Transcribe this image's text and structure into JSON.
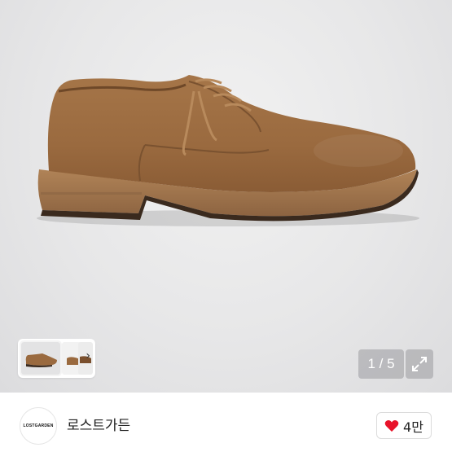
{
  "gallery": {
    "current_page": "1",
    "total_pages": "5",
    "page_indicator": "1 / 5",
    "thumbnail_next_glyph": "›"
  },
  "store": {
    "logo_text": "LOSTGARDEN",
    "name": "로스트가든"
  },
  "like": {
    "count": "4만",
    "heart_color": "#e8132a"
  },
  "icons": {
    "expand": "expand-icon",
    "heart": "heart-icon",
    "chevron": "chevron-right-icon"
  }
}
